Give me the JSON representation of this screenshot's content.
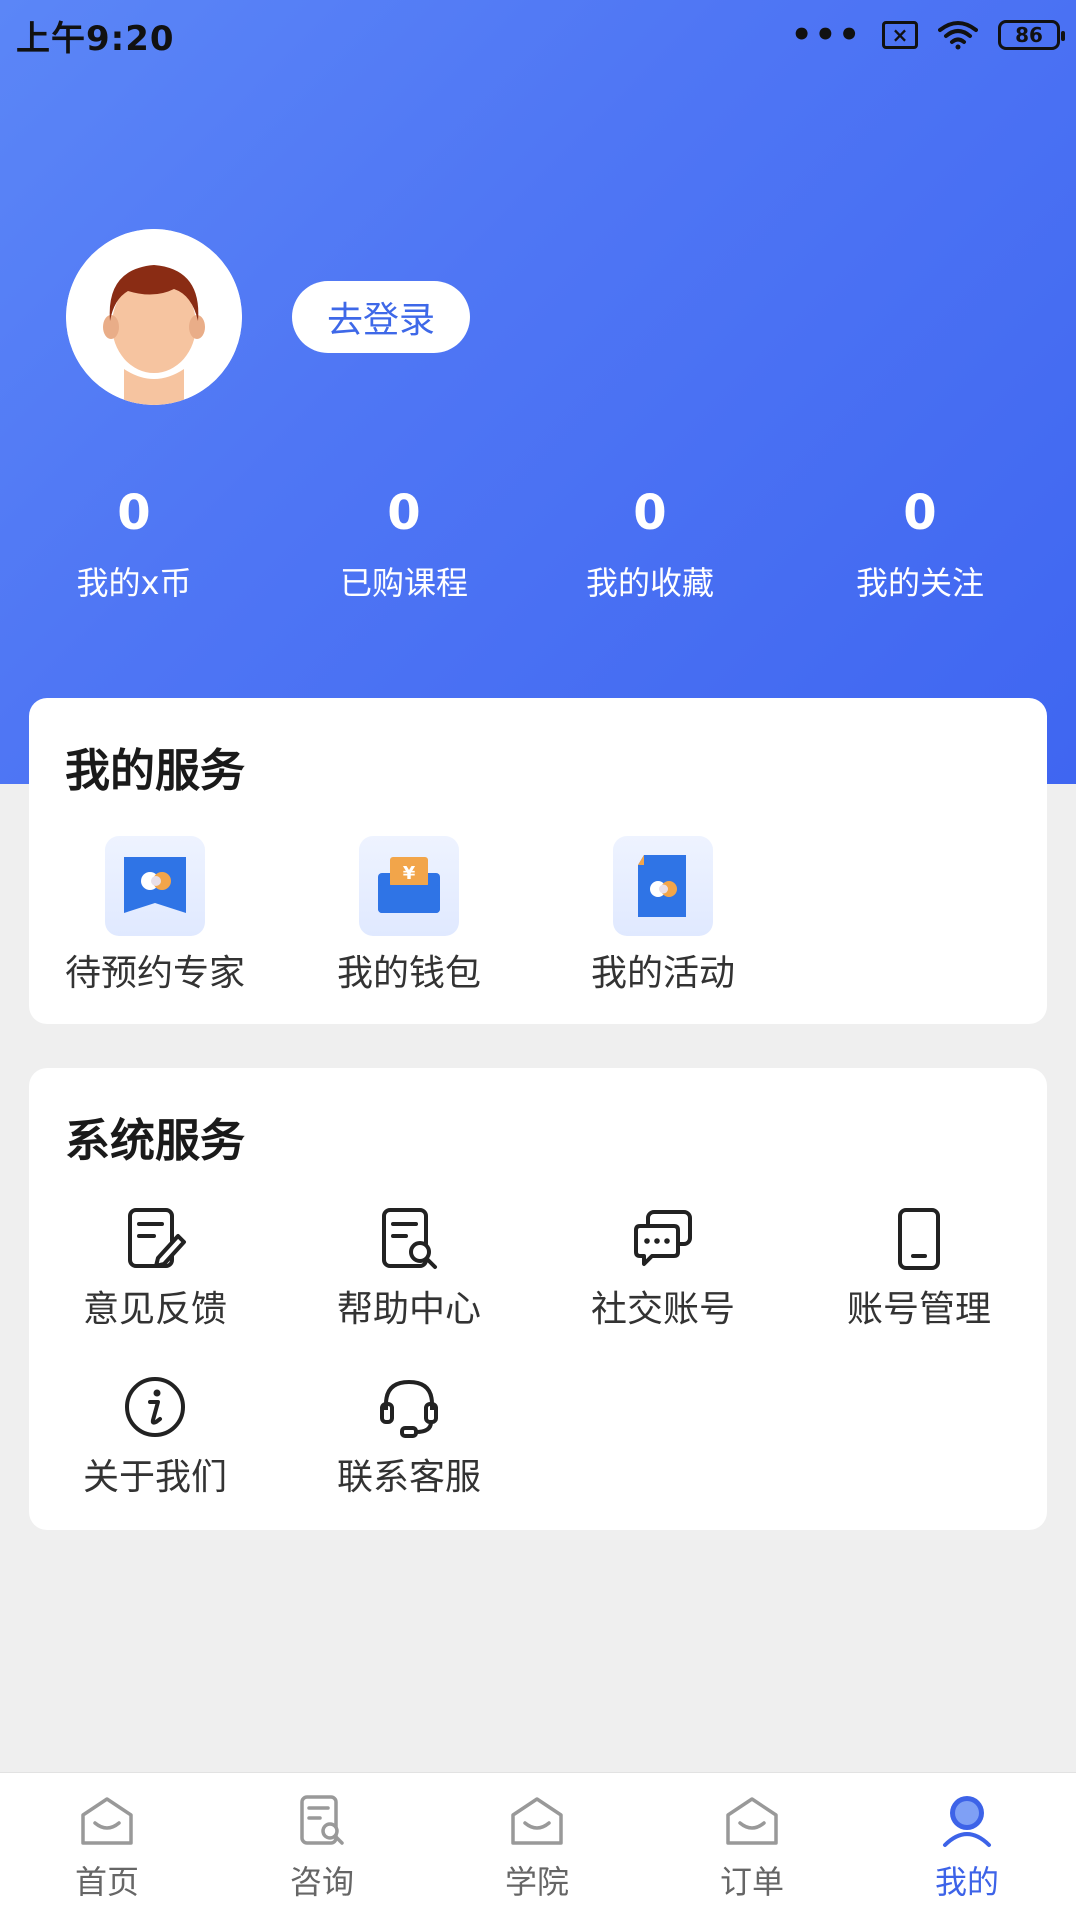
{
  "status_bar": {
    "time": "上午9:20",
    "dots": "•••",
    "sim": "×",
    "battery": "86"
  },
  "profile": {
    "login_label": "去登录"
  },
  "stats": [
    {
      "value": "0",
      "label": "我的x币"
    },
    {
      "value": "0",
      "label": "已购课程"
    },
    {
      "value": "0",
      "label": "我的收藏"
    },
    {
      "value": "0",
      "label": "我的关注"
    }
  ],
  "my_services": {
    "title": "我的服务",
    "items": [
      {
        "label": "待预约专家",
        "icon": "appointment-icon"
      },
      {
        "label": "我的钱包",
        "icon": "wallet-icon"
      },
      {
        "label": "我的活动",
        "icon": "activity-icon"
      }
    ]
  },
  "system_services": {
    "title": "系统服务",
    "items": [
      {
        "label": "意见反馈",
        "icon": "feedback-icon"
      },
      {
        "label": "帮助中心",
        "icon": "help-center-icon"
      },
      {
        "label": "社交账号",
        "icon": "social-account-icon"
      },
      {
        "label": "账号管理",
        "icon": "account-management-icon"
      },
      {
        "label": "关于我们",
        "icon": "about-us-icon"
      },
      {
        "label": "联系客服",
        "icon": "customer-service-icon"
      }
    ]
  },
  "tabbar": {
    "items": [
      {
        "label": "首页",
        "icon": "home-icon",
        "active": false
      },
      {
        "label": "咨询",
        "icon": "consult-icon",
        "active": false
      },
      {
        "label": "学院",
        "icon": "academy-icon",
        "active": false
      },
      {
        "label": "订单",
        "icon": "order-icon",
        "active": false
      },
      {
        "label": "我的",
        "icon": "profile-icon",
        "active": true
      }
    ]
  },
  "colors": {
    "accent": "#3d63e8",
    "hero_start": "#5b86f7",
    "hero_end": "#3f66f1",
    "background": "#efefef"
  }
}
